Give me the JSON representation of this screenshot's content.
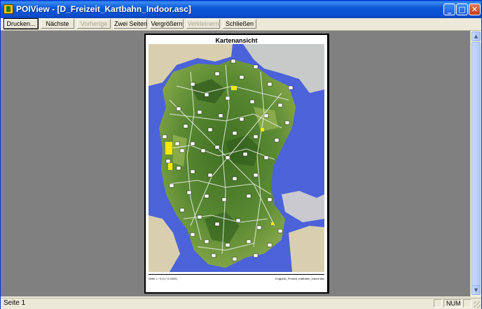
{
  "window": {
    "title": "POIView - [D_Freizeit_Kartbahn_Indoor.asc]",
    "controls": {
      "minimize": "_",
      "maximize": "□",
      "close": "✕"
    }
  },
  "toolbar": {
    "buttons": [
      {
        "label": "Drucken...",
        "enabled": true,
        "default": true
      },
      {
        "label": "Nächste",
        "enabled": true
      },
      {
        "label": "Vorherige",
        "enabled": false
      },
      {
        "label": "Zwei Seiten",
        "enabled": true
      },
      {
        "label": "Vergrößern",
        "enabled": true
      },
      {
        "label": "Verkleinern",
        "enabled": false
      },
      {
        "label": "Schließen",
        "enabled": true
      }
    ]
  },
  "preview": {
    "page_title": "Kartenansicht",
    "footer_left": "Seite 1 / 9 (3.7.0.2020)",
    "footer_right": "D:\\gps\\D_Freizeit_Kartbahn_Indoor.asc",
    "map_colors": {
      "water": "#4c62d8",
      "land": "#4f7f2e",
      "land_light": "#9ab858",
      "sand": "#d9cfae",
      "roads": "#e8efe6",
      "highlight": "#f6ea00"
    }
  },
  "scrollbar": {
    "up": "▲",
    "down": "▼"
  },
  "status": {
    "left": "Seite 1",
    "num": "NUM"
  }
}
